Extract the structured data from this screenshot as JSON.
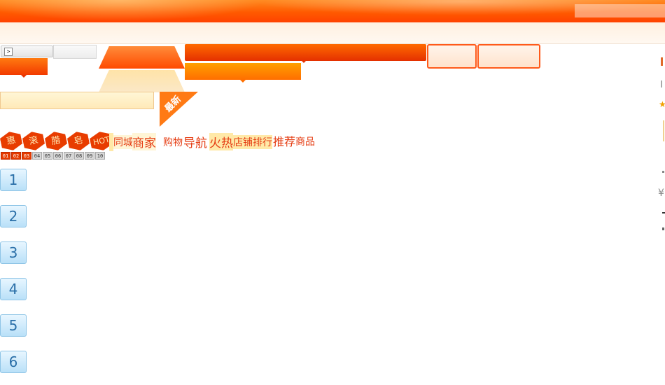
{
  "header": {
    "accent": "#ff5a00"
  },
  "widgets": {
    "scroll_arrow": ">"
  },
  "newest_ribbon": {
    "label": "最新"
  },
  "tags": {
    "t1": "惠",
    "t2": "滚",
    "t3": "腊",
    "t4": "皂",
    "hot": "HOT"
  },
  "nav": {
    "tongcheng": "同城",
    "shangjia": "商家",
    "gouwu": "购物",
    "daohang": "导航",
    "huore": "火热",
    "dianpu": "店铺排行",
    "tuijian": "推荐",
    "shangpin": "商品"
  },
  "pager": [
    "01",
    "02",
    "03",
    "04",
    "05",
    "06",
    "07",
    "08",
    "09",
    "10"
  ],
  "pager_active_count": 3,
  "numbers": [
    "1",
    "2",
    "3",
    "4",
    "5",
    "6"
  ],
  "right_edge": {
    "yen": "¥",
    "star": "★"
  }
}
